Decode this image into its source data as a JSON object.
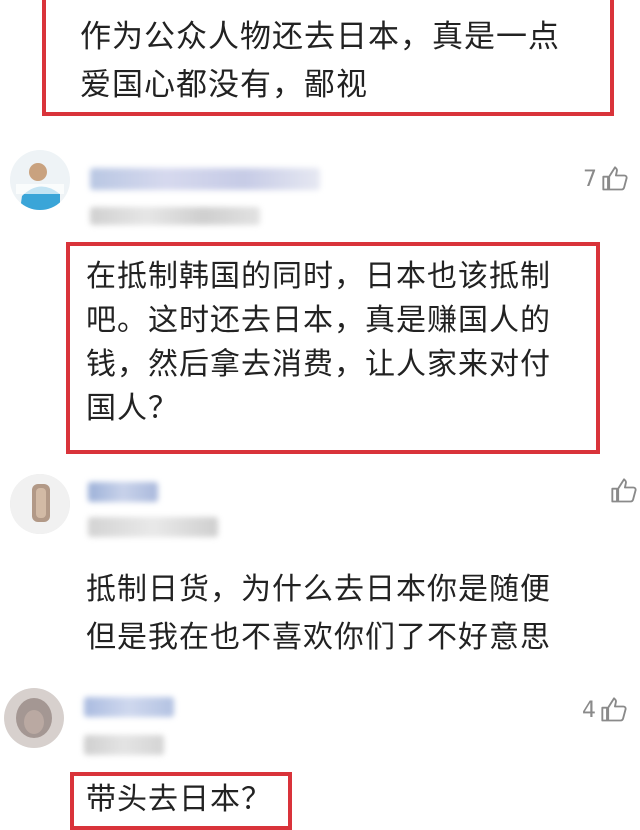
{
  "comments": [
    {
      "text_lines": [
        "作为公众人物还去日本，真是一点",
        "爱国心都没有，鄙视"
      ],
      "highlighted": true
    },
    {
      "like_count": "7",
      "text_lines": [
        "在抵制韩国的同时，日本也该抵制",
        "吧。这时还去日本，真是赚国人的",
        "钱，然后拿去消费，让人家来对付",
        "国人？"
      ],
      "highlighted": true
    },
    {
      "like_count": "",
      "text_lines": [
        "抵制日货，为什么去日本你是随便",
        "但是我在也不喜欢你们了不好意思"
      ],
      "highlighted": false
    },
    {
      "like_count": "4",
      "text_lines": [
        "带头去日本？"
      ],
      "highlighted": true
    }
  ],
  "icons": {
    "like": "thumbs-up-icon",
    "avatar": "user-avatar"
  },
  "colors": {
    "highlight": "#d9333a",
    "muted": "#8a8a8a"
  }
}
